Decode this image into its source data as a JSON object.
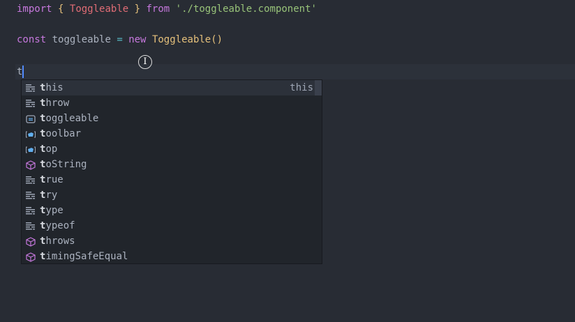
{
  "editor": {
    "lines": [
      {
        "import": "import",
        "ob": "{",
        "name": "Toggleable",
        "cb": "}",
        "from": "from",
        "path": "'./toggleable.component'"
      },
      {
        "const": "const",
        "var": "toggleable",
        "eq": "=",
        "new": "new",
        "ctor": "Toggleable",
        "parens": "()"
      }
    ],
    "typed": "t"
  },
  "autocomplete": {
    "items": [
      {
        "match": "t",
        "rest": "his",
        "icon": "keyword-icon",
        "detail": "this"
      },
      {
        "match": "t",
        "rest": "hrow",
        "icon": "keyword-icon"
      },
      {
        "match": "t",
        "rest": "oggleable",
        "icon": "variable-icon"
      },
      {
        "match": "t",
        "rest": "oolbar",
        "icon": "field-icon"
      },
      {
        "match": "t",
        "rest": "op",
        "icon": "field-icon"
      },
      {
        "match": "t",
        "rest": "oString",
        "icon": "method-icon"
      },
      {
        "match": "t",
        "rest": "rue",
        "icon": "keyword-icon"
      },
      {
        "match": "t",
        "rest": "ry",
        "icon": "keyword-icon"
      },
      {
        "match": "t",
        "rest": "ype",
        "icon": "keyword-icon"
      },
      {
        "match": "t",
        "rest": "ypeof",
        "icon": "keyword-icon"
      },
      {
        "match": "t",
        "rest": "hrows",
        "icon": "method-icon"
      },
      {
        "match": "t",
        "rest": "imingSafeEqual",
        "icon": "method-icon"
      }
    ]
  },
  "colors": {
    "accent": "#528bff",
    "keyword": "#c678dd",
    "string": "#98c379",
    "class": "#e06c75"
  }
}
